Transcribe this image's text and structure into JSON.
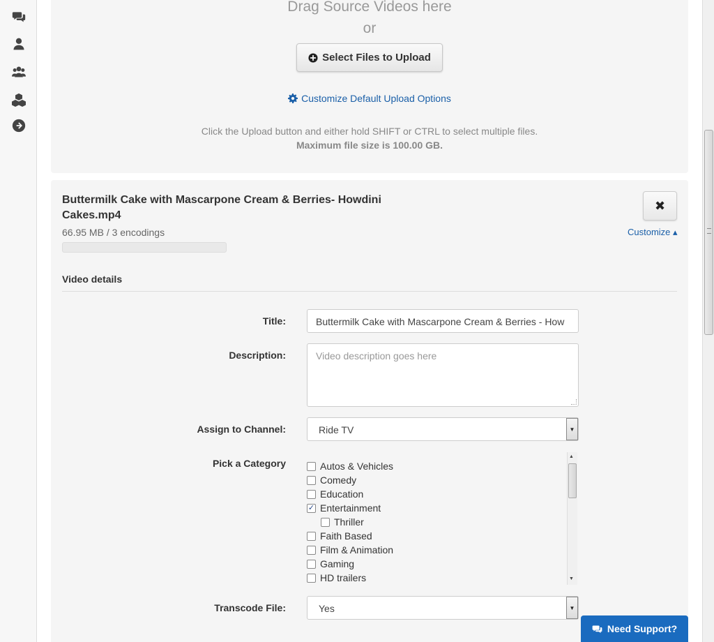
{
  "sidebar": {
    "icons": [
      "comments-icon",
      "user-icon",
      "users-icon",
      "cubes-icon",
      "arrow-circle-right-icon"
    ]
  },
  "upload": {
    "drop_title": "Drag Source Videos here",
    "or_text": "or",
    "select_button": "Select Files to Upload",
    "customize_link": "Customize Default Upload Options",
    "help_text": "Click the Upload button and either hold SHIFT or CTRL to select multiple files.",
    "max_size": "Maximum file size is 100.00 GB."
  },
  "file": {
    "name": "Buttermilk Cake with Mascarpone Cream & Berries- Howdini Cakes.mp4",
    "meta": "66.95 MB / 3 encodings",
    "progress": 0,
    "close_label": "✖",
    "customize_label": "Customize ▴"
  },
  "details": {
    "section_title": "Video details",
    "title_label": "Title:",
    "title_value": "Buttermilk Cake with Mascarpone Cream & Berries -  How",
    "description_label": "Description:",
    "description_placeholder": "Video description goes here",
    "channel_label": "Assign to Channel:",
    "channel_value": "Ride TV",
    "category_label": "Pick a Category",
    "categories": [
      {
        "label": "Autos & Vehicles",
        "checked": false,
        "indent": 0
      },
      {
        "label": "Comedy",
        "checked": false,
        "indent": 0
      },
      {
        "label": "Education",
        "checked": false,
        "indent": 0
      },
      {
        "label": "Entertainment",
        "checked": true,
        "indent": 0
      },
      {
        "label": "Thriller",
        "checked": false,
        "indent": 1
      },
      {
        "label": "Faith Based",
        "checked": false,
        "indent": 0
      },
      {
        "label": "Film & Animation",
        "checked": false,
        "indent": 0
      },
      {
        "label": "Gaming",
        "checked": false,
        "indent": 0
      },
      {
        "label": "HD trailers",
        "checked": false,
        "indent": 0
      }
    ],
    "transcode_label": "Transcode File:",
    "transcode_value": "Yes"
  },
  "support": {
    "label": "Need Support?"
  },
  "colors": {
    "link": "#1a5fa8",
    "support_bg": "#1a6bbf",
    "panel_bg": "#f5f5f5"
  }
}
